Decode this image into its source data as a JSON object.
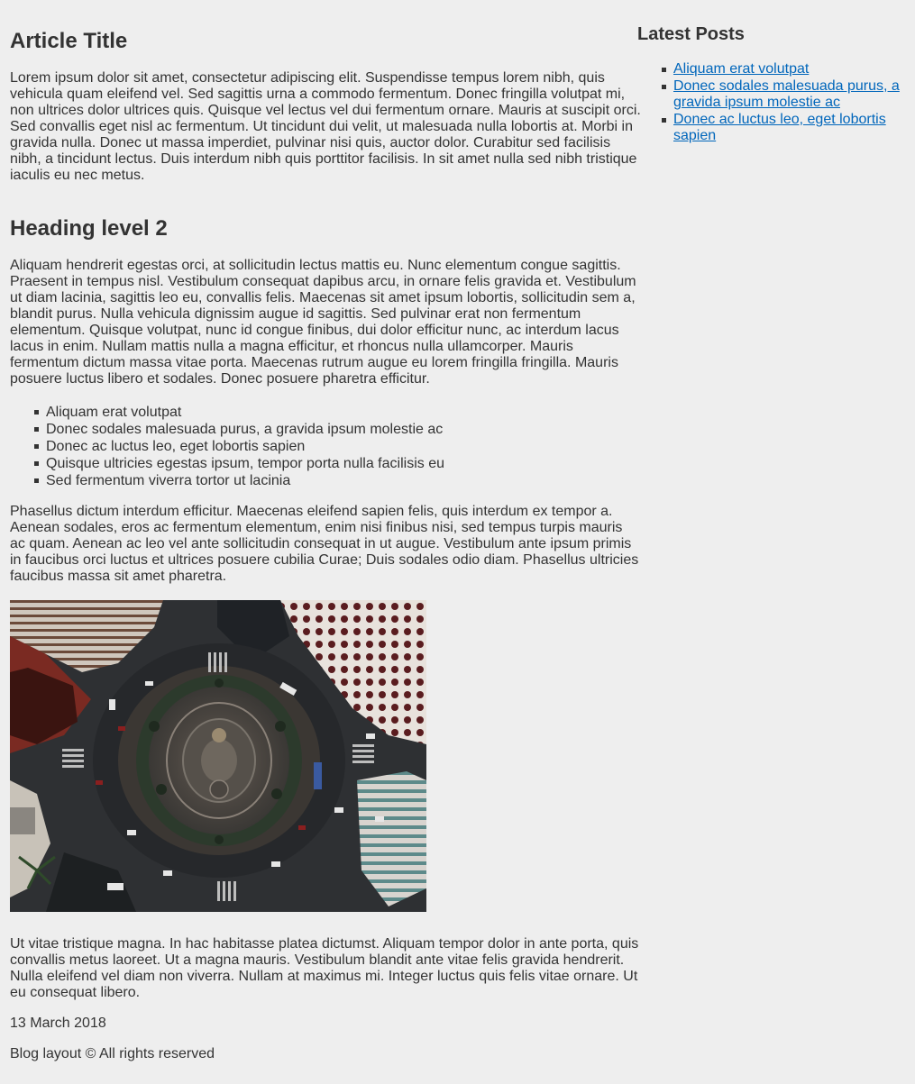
{
  "article": {
    "title": "Article Title",
    "intro": "Lorem ipsum dolor sit amet, consectetur adipiscing elit. Suspendisse tempus lorem nibh, quis vehicula quam eleifend vel. Sed sagittis urna a commodo fermentum. Donec fringilla volutpat mi, non ultrices dolor ultrices quis. Quisque vel lectus vel dui fermentum ornare. Mauris at suscipit orci. Sed convallis eget nisl ac fermentum. Ut tincidunt dui velit, ut malesuada nulla lobortis at. Morbi in gravida nulla. Donec ut massa imperdiet, pulvinar nisi quis, auctor dolor. Curabitur sed facilisis nibh, a tincidunt lectus. Duis interdum nibh quis porttitor facilisis. In sit amet nulla sed nibh tristique iaculis eu nec metus.",
    "heading2": "Heading level 2",
    "paragraph2": "Aliquam hendrerit egestas orci, at sollicitudin lectus mattis eu. Nunc elementum congue sagittis. Praesent in tempus nisl. Vestibulum consequat dapibus arcu, in ornare felis gravida et. Vestibulum ut diam lacinia, sagittis leo eu, convallis felis. Maecenas sit amet ipsum lobortis, sollicitudin sem a, blandit purus. Nulla vehicula dignissim augue id sagittis. Sed pulvinar erat non fermentum elementum. Quisque volutpat, nunc id congue finibus, dui dolor efficitur nunc, ac interdum lacus lacus in enim. Nullam mattis nulla a magna efficitur, et rhoncus nulla ullamcorper. Mauris fermentum dictum massa vitae porta. Maecenas rutrum augue eu lorem fringilla fringilla. Mauris posuere luctus libero et sodales. Donec posuere pharetra efficitur.",
    "list": [
      "Aliquam erat volutpat",
      "Donec sodales malesuada purus, a gravida ipsum molestie ac",
      "Donec ac luctus leo, eget lobortis sapien",
      "Quisque ultricies egestas ipsum, tempor porta nulla facilisis eu",
      "Sed fermentum viverra tortor ut lacinia"
    ],
    "paragraph3": "Phasellus dictum interdum efficitur. Maecenas eleifend sapien felis, quis interdum ex tempor a. Aenean sodales, eros ac fermentum elementum, enim nisi finibus nisi, sed tempus turpis mauris ac quam. Aenean ac leo vel ante sollicitudin consequat in ut augue. Vestibulum ante ipsum primis in faucibus orci luctus et ultrices posuere cubilia Curae; Duis sodales odio diam. Phasellus ultricies faucibus massa sit amet pharetra.",
    "paragraph4": "Ut vitae tristique magna. In hac habitasse platea dictumst. Aliquam tempor dolor in ante porta, quis convallis metus laoreet. Ut a magna mauris. Vestibulum blandit ante vitae felis gravida hendrerit. Nulla eleifend vel diam non viverra. Nullam at maximus mi. Integer luctus quis felis vitae ornare. Ut eu consequat libero.",
    "date": "13 March 2018",
    "footer": "Blog layout © All rights reserved"
  },
  "sidebar": {
    "title": "Latest Posts",
    "posts": [
      "Aliquam erat volutpat",
      "Donec sodales malesuada purus, a gravida ipsum molestie ac",
      "Donec ac luctus leo, eget lobortis sapien"
    ]
  },
  "colors": {
    "background": "#eeeeee",
    "text": "#333333",
    "link": "#0066bb"
  }
}
